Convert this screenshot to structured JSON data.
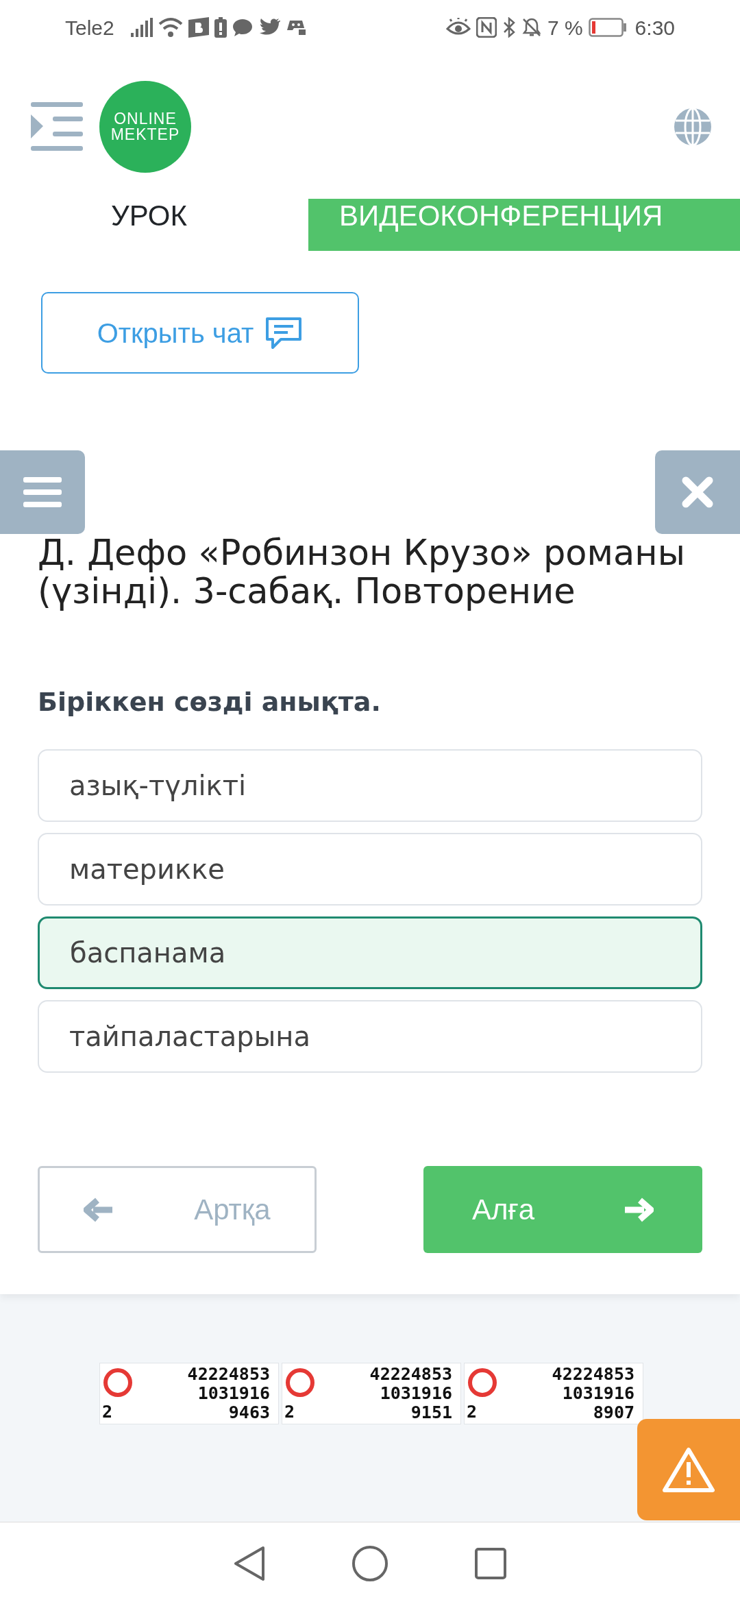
{
  "status_bar": {
    "carrier": "Tele2",
    "battery_text": "7 %",
    "time": "6:30"
  },
  "header": {
    "logo_lines": [
      "ONLINE",
      "MEKTEP"
    ]
  },
  "nav_links": [
    {
      "label": "УРОК",
      "kind": "plain"
    },
    {
      "label": "ВИДЕОКОНФЕРЕНЦИЯ",
      "kind": "button"
    }
  ],
  "chat_button": "Открыть чат",
  "lesson_title": "Д. Дефо «Робинзон Крузо» романы (үзінді). 3-сабақ. Повторение",
  "question": "Біріккен сөзді анықта.",
  "options": [
    {
      "text": "азық-түлікті",
      "selected": false
    },
    {
      "text": "материкке",
      "selected": false
    },
    {
      "text": "баспанама",
      "selected": true
    },
    {
      "text": "тайпаластарына",
      "selected": false
    }
  ],
  "back_button": {
    "label": "Артқа",
    "disabled": true
  },
  "next_button": {
    "label": "Алға",
    "disabled": false
  },
  "counters": [
    {
      "lines": [
        "42224853",
        "1031916",
        "9463"
      ],
      "corner": "2"
    },
    {
      "lines": [
        "42224853",
        "1031916",
        "9151"
      ],
      "corner": "2"
    },
    {
      "lines": [
        "42224853",
        "1031916",
        "8907"
      ],
      "corner": "2"
    }
  ]
}
